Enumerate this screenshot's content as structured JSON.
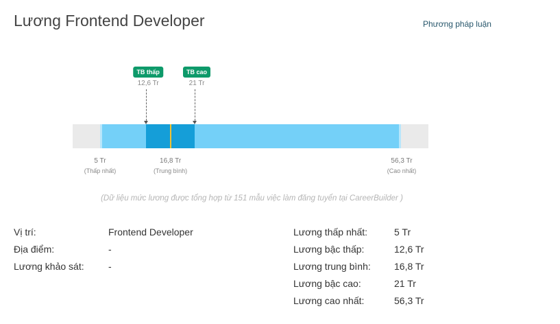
{
  "header": {
    "title": "Lương Frontend Developer",
    "methodology_link": "Phương pháp luận"
  },
  "chart_data": {
    "type": "range",
    "unit": "Tr",
    "min": 5,
    "low_avg": 12.6,
    "average": 16.8,
    "high_avg": 21,
    "max": 56.3,
    "badges": [
      {
        "label": "TB thấp",
        "value_text": "12,6 Tr"
      },
      {
        "label": "TB cao",
        "value_text": "21 Tr"
      }
    ],
    "ticks": [
      {
        "value_text": "5 Tr",
        "sub": "(Thấp nhất)"
      },
      {
        "value_text": "16,8 Tr",
        "sub": "(Trung bình)"
      },
      {
        "value_text": "56,3 Tr",
        "sub": "(Cao nhất)"
      }
    ],
    "colors": {
      "track": "#eaeaea",
      "full_range": "#74d0f8",
      "mid_range": "#159ed8",
      "average_marker": "#f2c230",
      "badge": "#0e9a6a"
    }
  },
  "note": "(Dữ liệu mức lương được tổng hợp từ 151 mẫu việc làm đăng tuyển tại CareerBuilder )",
  "details_left": [
    {
      "label": "Vị trí:",
      "value": "Frontend Developer"
    },
    {
      "label": "Địa điểm:",
      "value": "-"
    },
    {
      "label": "Lương khảo sát:",
      "value": "-"
    }
  ],
  "details_right": [
    {
      "label": "Lương thấp nhất:",
      "value": "5 Tr"
    },
    {
      "label": "Lương bậc thấp:",
      "value": "12,6 Tr"
    },
    {
      "label": "Lương trung bình:",
      "value": "16,8 Tr"
    },
    {
      "label": "Lương bậc cao:",
      "value": "21 Tr"
    },
    {
      "label": "Lương cao nhất:",
      "value": "56,3 Tr"
    }
  ]
}
